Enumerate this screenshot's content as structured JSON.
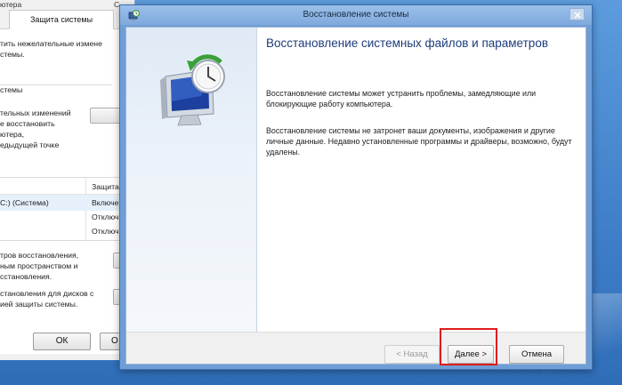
{
  "background_dialog": {
    "tab_row_labels": [
      "ютера",
      "С"
    ],
    "active_tab": "Защита системы",
    "intro_lines": [
      "тить нежелательные измене",
      "стемы."
    ],
    "group_title": "стемы",
    "restore_lines": [
      "тельных изменений",
      "е восстановить",
      "ютера,",
      "едыдущей точке"
    ],
    "table_header_left": "",
    "table_header_right": "Защита",
    "table_rows": [
      {
        "left": "С:) (Система)",
        "right": "Включе"
      },
      {
        "left": "",
        "right": "Отключ"
      },
      {
        "left": "",
        "right": "Отключ"
      }
    ],
    "config_lines": [
      "тров восстановления,",
      "ным пространством и",
      "сстановления."
    ],
    "create_lines": [
      "становления для дисков с",
      "ией защиты системы."
    ],
    "ok_label": "ОК",
    "cancel_partial_label": "О"
  },
  "wizard": {
    "title": "Восстановление системы",
    "heading": "Восстановление системных файлов и параметров",
    "paragraph1": "Восстановление системы может устранить проблемы, замедляющие или блокирующие работу компьютера.",
    "paragraph2": "Восстановление системы не затронет ваши документы, изображения и другие личные данные. Недавно установленные программы и драйверы, возможно, будут удалены.",
    "back_label": "< Назад",
    "next_label": "Далее >",
    "cancel_label": "Отмена"
  },
  "colors": {
    "heading": "#1d3c7a",
    "highlight": "#e01b1b",
    "desktop": "#4f8ed4"
  },
  "icons": {
    "title_icon": "system-restore-icon",
    "side_art": "system-restore-monitor-clock-icon",
    "close": "close-icon"
  }
}
